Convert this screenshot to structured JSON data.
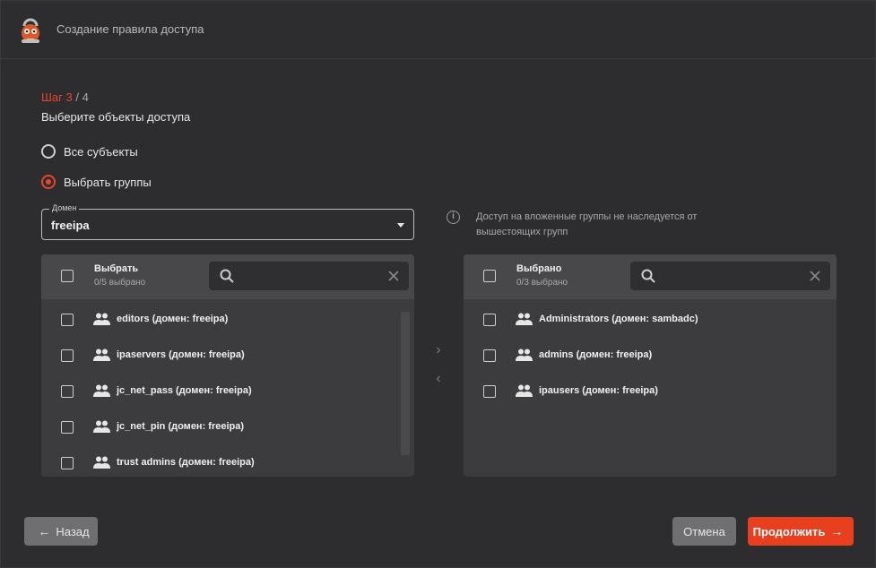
{
  "header": {
    "title": "Создание правила доступа"
  },
  "step": {
    "current": "Шаг 3",
    "total": " / 4"
  },
  "subtitle": "Выберите объекты доступа",
  "radios": [
    {
      "label": "Все субъекты",
      "checked": false
    },
    {
      "label": "Выбрать группы",
      "checked": true
    }
  ],
  "domain_select": {
    "legend": "Домен",
    "value": "freeipa"
  },
  "info": {
    "text": "Доступ на вложенные группы не наследуется от вышестоящих групп"
  },
  "left_panel": {
    "title": "Выбрать",
    "count": "0/5 выбрано",
    "search_placeholder": "",
    "items": [
      "editors (домен: freeipa)",
      "ipaservers (домен: freeipa)",
      "jc_net_pass (домен: freeipa)",
      "jc_net_pin (домен: freeipa)",
      "trust admins (домен: freeipa)"
    ]
  },
  "right_panel": {
    "title": "Выбрано",
    "count": "0/3 выбрано",
    "search_placeholder": "",
    "items": [
      "Administrators (домен: sambadc)",
      "admins (домен: freeipa)",
      "ipausers (домен: freeipa)"
    ]
  },
  "transfer": {
    "right": "›",
    "left": "‹"
  },
  "buttons": {
    "back": "Назад",
    "cancel": "Отмена",
    "next": "Продолжить"
  },
  "colors": {
    "accent": "#e8452a",
    "background": "#2d2d30",
    "panel": "#3c3c3f"
  }
}
